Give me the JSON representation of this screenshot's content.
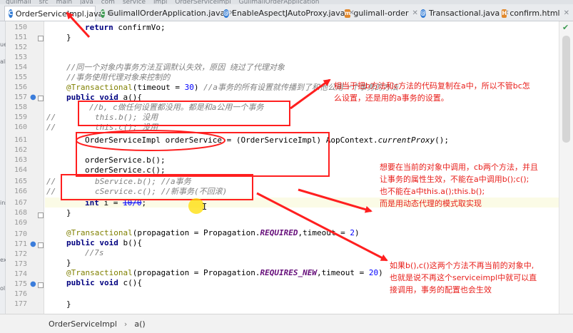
{
  "topstrip": [
    "gulimall",
    "src",
    "main",
    "java",
    "com",
    "service",
    "impl",
    "OrderServiceImpl",
    "GulimallOrderApplication"
  ],
  "tabs": [
    {
      "label": "OrderServiceImpl.java",
      "icon": "class-icon",
      "active": true
    },
    {
      "label": "GulimallOrderApplication.java",
      "icon": "app-class-icon",
      "active": false
    },
    {
      "label": "EnableAspectJAutoProxy.java",
      "icon": "annotation-icon",
      "active": false
    },
    {
      "label": "gulimall-order",
      "icon": "module-icon",
      "active": false
    },
    {
      "label": "Transactional.java",
      "icon": "annotation-icon",
      "active": false
    },
    {
      "label": "confirm.html",
      "icon": "html-icon",
      "active": false
    }
  ],
  "side_markers": [
    "ue",
    "ali",
    "ins",
    "ex",
    "ol"
  ],
  "line_numbers": [
    "150",
    "151",
    "152",
    "153",
    "154",
    "155",
    "156",
    "157",
    "158",
    "159",
    "160",
    "161",
    "162",
    "163",
    "164",
    "165",
    "166",
    "167",
    "168",
    "169",
    "170",
    "171",
    "172",
    "173",
    "174",
    "175",
    "176",
    "177"
  ],
  "code": {
    "l150": {
      "kw": "return",
      "rest": " confirmVo;"
    },
    "l151": "}",
    "l154": "//同一个对象内事务方法互调默认失效，原因 绕过了代理对象",
    "l155": "//事务使用代理对象来控制的",
    "l156": {
      "ann": "@Transactional",
      "p1": "(timeout = ",
      "num": "30",
      "p2": ") ",
      "cm": "//a事务的所有设置就传播到了和他公用一个事务的方法"
    },
    "l157": {
      "kw1": "public",
      "kw2": "void",
      "rest": " a(){"
    },
    "l158": "//b, c做任何设置都没用。都是和a公用一个事务",
    "l159": "this.b(); 没用",
    "l160": "this.c(); 没用",
    "l161": {
      "type": "OrderServiceImpl orderService = (OrderServiceImpl) AopContext.",
      "method": "currentProxy",
      "end": "();"
    },
    "l163": "orderService.b();",
    "l164": "orderService.c();",
    "l165": "bService.b(); //a事务",
    "l166": "cService.c(); //新事务(不回滚)",
    "l167": {
      "kw": "int",
      "mid": " i = ",
      "strike": "10/0",
      "end": ";"
    },
    "l168": "}",
    "l170": {
      "ann": "@Transactional",
      "p1": "(propagation = Propagation.",
      "const": "REQUIRED",
      "p2": ",timeout = ",
      "num": "2",
      "p3": ")"
    },
    "l171": {
      "kw1": "public",
      "kw2": "void",
      "rest": " b(){"
    },
    "l172": "//7s",
    "l173": "}",
    "l174": {
      "ann": "@Transactional",
      "p1": "(propagation = Propagation.",
      "const": "REQUIRES_NEW",
      "p2": ",timeout = ",
      "num": "20",
      "p3": ")"
    },
    "l175": {
      "kw1": "public",
      "kw2": "void",
      "rest": " c(){"
    },
    "l177": "}"
  },
  "breadcrumb": [
    "OrderServiceImpl",
    "a()"
  ],
  "annotations": {
    "note1_line1": "相当于把b方法和c方法的代码复制在a中，所以不管bc怎",
    "note1_line2": "么设置，还是用的a事务的设置。",
    "note2_line1": "想要在当前的对象中调用，cb两个方法，并且",
    "note2_line2": "让事务的属性生效，不能在a中调用b();c();",
    "note2_line3": "也不能在a中this.a();this.b();",
    "note2_line4": "而是用动态代理的模式取实现",
    "note3_line1": "如果b(),c()这两个方法不再当前的对象中,",
    "note3_line2": "也就是说不再这个serviceimpl中就可以直",
    "note3_line3": "接调用，事务的配置也会生效"
  },
  "colors": {
    "annotation_red": "#ff1f1f",
    "note_red": "#e8201c",
    "keyword": "#000080",
    "annotation": "#808000",
    "comment": "#808080",
    "constant": "#660e7a"
  }
}
